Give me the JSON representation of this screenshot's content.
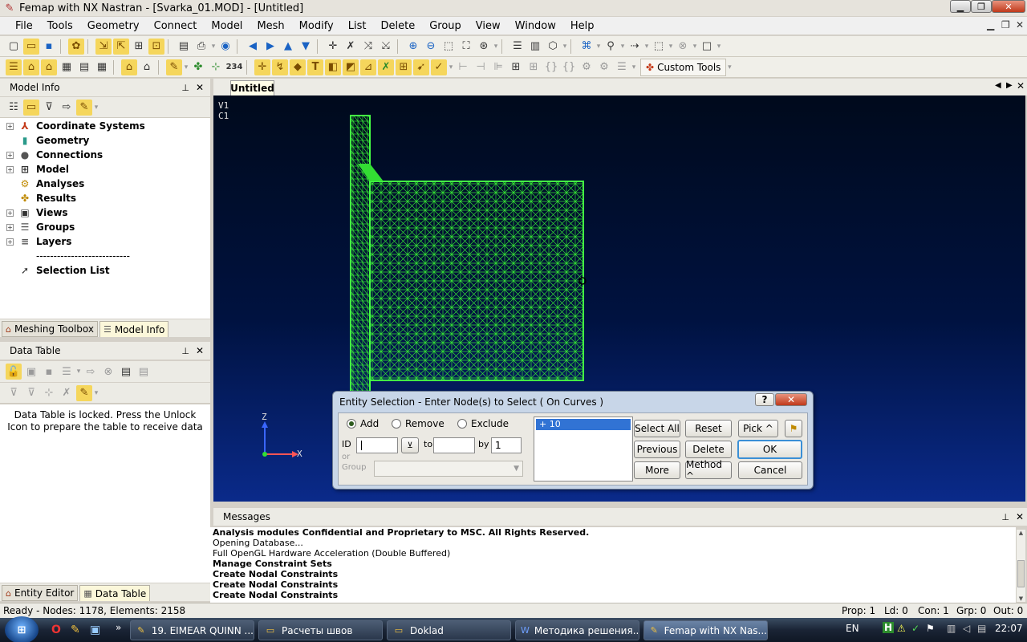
{
  "window": {
    "title": "Femap with NX Nastran - [Svarka_01.MOD] - [Untitled]",
    "min_icon": "minimize-icon",
    "max_icon": "restore-icon",
    "close_icon": "close-icon"
  },
  "menu": [
    "File",
    "Tools",
    "Geometry",
    "Connect",
    "Model",
    "Mesh",
    "Modify",
    "List",
    "Delete",
    "Group",
    "View",
    "Window",
    "Help"
  ],
  "toolbar": {
    "custom_tools_label": "Custom Tools",
    "number_badge": "234"
  },
  "model_info": {
    "title": "Model Info",
    "tree": [
      {
        "label": "Coordinate Systems",
        "expandable": true,
        "icon": "coordinate-icon"
      },
      {
        "label": "Geometry",
        "expandable": false,
        "icon": "geometry-icon"
      },
      {
        "label": "Connections",
        "expandable": true,
        "icon": "connections-icon"
      },
      {
        "label": "Model",
        "expandable": true,
        "icon": "model-icon"
      },
      {
        "label": "Analyses",
        "expandable": false,
        "icon": "analyses-icon"
      },
      {
        "label": "Results",
        "expandable": false,
        "icon": "results-icon"
      },
      {
        "label": "Views",
        "expandable": true,
        "icon": "views-icon"
      },
      {
        "label": "Groups",
        "expandable": true,
        "icon": "groups-icon"
      },
      {
        "label": "Layers",
        "expandable": true,
        "icon": "layers-icon"
      },
      {
        "label": "---------------------------",
        "expandable": false,
        "icon": ""
      },
      {
        "label": "Selection List",
        "expandable": false,
        "icon": "selection-icon"
      }
    ],
    "tabs": [
      "Meshing Toolbox",
      "Model Info"
    ]
  },
  "data_table": {
    "title": "Data Table",
    "locked_message": "Data Table is locked. Press the Unlock Icon to prepare the table to receive data",
    "tabs": [
      "Entity Editor",
      "Data Table"
    ]
  },
  "graphics": {
    "tab_label": "Untitled",
    "view_label": "V1",
    "csys_label": "C1",
    "axis_z": "Z",
    "axis_x": "X",
    "mesh_color": "#33dd33",
    "bg_top": "#000a1c",
    "bg_bottom": "#0a2a8a"
  },
  "dialog": {
    "title": "Entity Selection - Enter Node(s) to Select  ( On Curves )",
    "help_label": "?",
    "radio_add": "Add",
    "radio_remove": "Remove",
    "radio_exclude": "Exclude",
    "id_label": "ID",
    "or_label": "or",
    "group_label": "Group",
    "to_label": "to",
    "by_label": "by",
    "by_value": "1",
    "id_value": "",
    "to_value": "",
    "list_items": [
      "+   10"
    ],
    "buttons": {
      "select_all": "Select All",
      "reset": "Reset",
      "pick": "Pick ^",
      "previous": "Previous",
      "delete": "Delete",
      "ok": "OK",
      "more": "More",
      "method": "Method ^",
      "cancel": "Cancel"
    }
  },
  "messages": {
    "title": "Messages",
    "lines": [
      {
        "text": "Analysis modules Confidential and Proprietary to MSC. All Rights Reserved.",
        "bold": true
      },
      {
        "text": "Opening Database...",
        "bold": false
      },
      {
        "text": "Full OpenGL Hardware Acceleration (Double Buffered)",
        "bold": false
      },
      {
        "text": "Manage Constraint Sets",
        "bold": true
      },
      {
        "text": "Create Nodal Constraints",
        "bold": true
      },
      {
        "text": "Create Nodal Constraints",
        "bold": true
      },
      {
        "text": "Create Nodal Constraints",
        "bold": true
      }
    ]
  },
  "status": {
    "left": "Ready - Nodes: 1178,  Elements: 2158",
    "prop": "Prop: 1",
    "ld": "Ld: 0",
    "con": "Con: 1",
    "grp": "Grp: 0",
    "out": "Out: 0"
  },
  "taskbar": {
    "tasks": [
      {
        "label": "19. EIMEAR QUINN ...",
        "icon": "media-icon",
        "active": false
      },
      {
        "label": "Расчеты швов",
        "icon": "folder-icon",
        "active": false
      },
      {
        "label": "Doklad",
        "icon": "folder-icon",
        "active": false
      },
      {
        "label": "Методика решения...",
        "icon": "word-icon",
        "active": false
      },
      {
        "label": "Femap with NX Nas...",
        "icon": "femap-icon",
        "active": true
      }
    ],
    "lang": "EN",
    "clock": "22:07"
  }
}
